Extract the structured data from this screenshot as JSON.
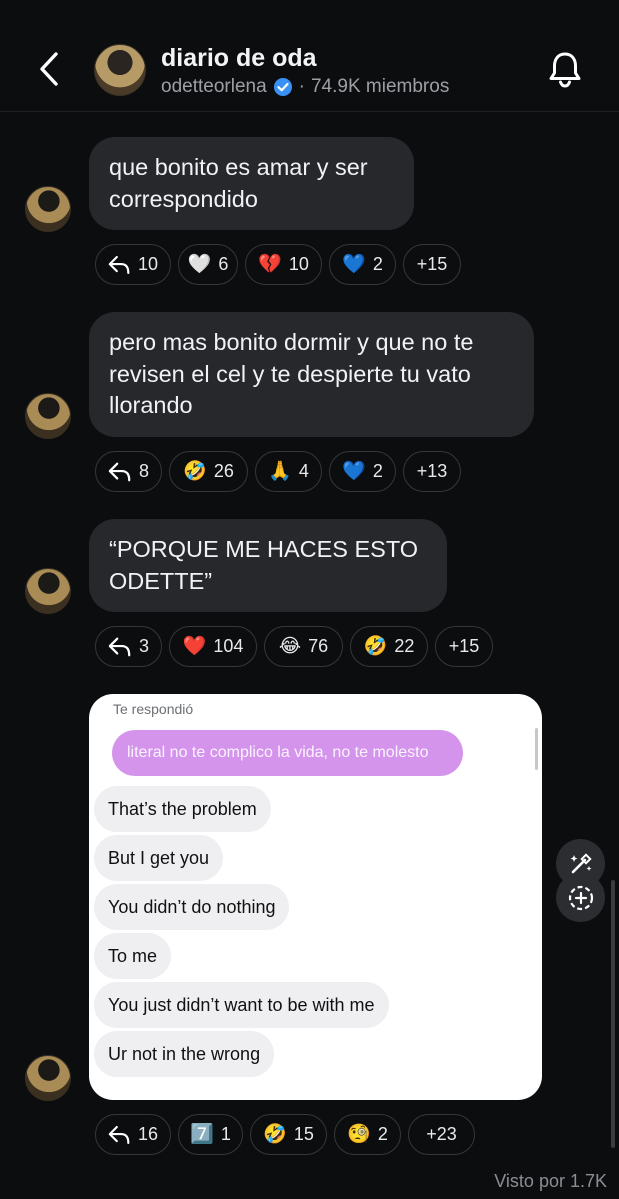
{
  "header": {
    "title": "diario de oda",
    "username": "odetteorlena",
    "members": "74.9K miembros"
  },
  "messages": [
    {
      "lines": [
        "que bonito es amar y ser",
        "correspondido"
      ],
      "reactions": [
        {
          "icon": "reply-icon",
          "emoji": "",
          "count": "10"
        },
        {
          "icon": "white-heart-icon",
          "emoji": "🤍",
          "count": "6"
        },
        {
          "icon": "broken-heart-icon",
          "emoji": "💔",
          "count": "10"
        },
        {
          "icon": "blue-heart-icon",
          "emoji": "💙",
          "count": "2"
        },
        {
          "icon": "",
          "emoji": "",
          "count": "+15"
        }
      ]
    },
    {
      "lines": [
        "pero mas bonito dormir y que no te",
        "revisen el cel y te despierte tu vato",
        "llorando"
      ],
      "reactions": [
        {
          "icon": "reply-icon",
          "emoji": "",
          "count": "8"
        },
        {
          "icon": "rofl-icon",
          "emoji": "🤣",
          "count": "26"
        },
        {
          "icon": "praying-hands-icon",
          "emoji": "🙏",
          "count": "4"
        },
        {
          "icon": "blue-heart-icon",
          "emoji": "💙",
          "count": "2"
        },
        {
          "icon": "",
          "emoji": "",
          "count": "+13"
        }
      ]
    },
    {
      "lines": [
        "“PORQUE ME HACES ESTO",
        "ODETTE”"
      ],
      "reactions": [
        {
          "icon": "reply-icon",
          "emoji": "",
          "count": "3"
        },
        {
          "icon": "red-heart-icon",
          "emoji": "❤️",
          "count": "104"
        },
        {
          "icon": "joy-icon",
          "emoji": "😂",
          "count": "76"
        },
        {
          "icon": "rofl-icon",
          "emoji": "🤣",
          "count": "22"
        },
        {
          "icon": "",
          "emoji": "",
          "count": "+15"
        }
      ]
    }
  ],
  "screenshot": {
    "label": "Te respondió",
    "quoted": "literal no te complico la vida, no te molesto",
    "replies": [
      "That’s the problem",
      "But I get you",
      "You didn’t do nothing",
      "To me",
      "You just didn’t want to be with me",
      "Ur not in the wrong"
    ],
    "reactions": [
      {
        "icon": "reply-icon",
        "emoji": "",
        "count": "16"
      },
      {
        "icon": "keycap-seven-icon",
        "emoji": "7️⃣",
        "count": "1"
      },
      {
        "icon": "rofl-icon",
        "emoji": "🤣",
        "count": "15"
      },
      {
        "icon": "monocle-face-icon",
        "emoji": "🧐",
        "count": "2"
      },
      {
        "icon": "",
        "emoji": "",
        "count": "+23"
      }
    ]
  },
  "footer": {
    "seen": "Visto por 1.7K"
  }
}
